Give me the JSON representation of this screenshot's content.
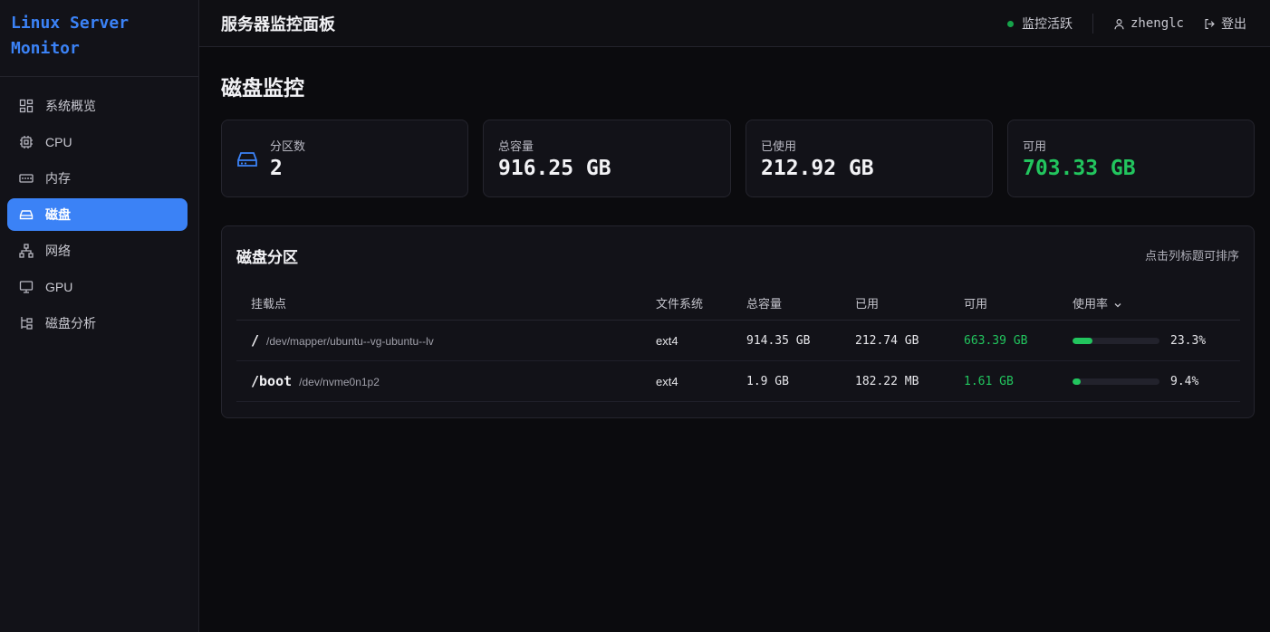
{
  "sidebar": {
    "brand": "Linux Server Monitor",
    "items": [
      {
        "label": "系统概览",
        "icon": "dashboard-icon"
      },
      {
        "label": "CPU",
        "icon": "cpu-icon"
      },
      {
        "label": "内存",
        "icon": "memory-icon"
      },
      {
        "label": "磁盘",
        "icon": "disk-icon",
        "active": true
      },
      {
        "label": "网络",
        "icon": "network-icon"
      },
      {
        "label": "GPU",
        "icon": "monitor-icon"
      },
      {
        "label": "磁盘分析",
        "icon": "tree-icon"
      }
    ]
  },
  "header": {
    "title": "服务器监控面板",
    "status": "监控活跃",
    "status_color": "#16a34a",
    "username": "zhenglc",
    "logout": "登出"
  },
  "page": {
    "title": "磁盘监控"
  },
  "stats": [
    {
      "label": "分区数",
      "value": "2",
      "icon": "hard-drive-icon"
    },
    {
      "label": "总容量",
      "value": "916.25 GB"
    },
    {
      "label": "已使用",
      "value": "212.92 GB"
    },
    {
      "label": "可用",
      "value": "703.33 GB",
      "color": "#22c55e"
    }
  ],
  "partitions": {
    "title": "磁盘分区",
    "hint": "点击列标题可排序",
    "columns": [
      "挂载点",
      "文件系统",
      "总容量",
      "已用",
      "可用",
      "使用率"
    ],
    "sort_column": "使用率",
    "rows": [
      {
        "mount": "/",
        "device": "/dev/mapper/ubuntu--vg-ubuntu--lv",
        "fs": "ext4",
        "total": "914.35 GB",
        "used": "212.74 GB",
        "free": "663.39 GB",
        "usage": "23.3%",
        "usage_fraction": 0.233
      },
      {
        "mount": "/boot",
        "device": "/dev/nvme0n1p2",
        "fs": "ext4",
        "total": "1.9 GB",
        "used": "182.22 MB",
        "free": "1.61 GB",
        "usage": "9.4%",
        "usage_fraction": 0.094
      }
    ]
  },
  "colors": {
    "accent": "#3b82f6",
    "success": "#22c55e"
  }
}
